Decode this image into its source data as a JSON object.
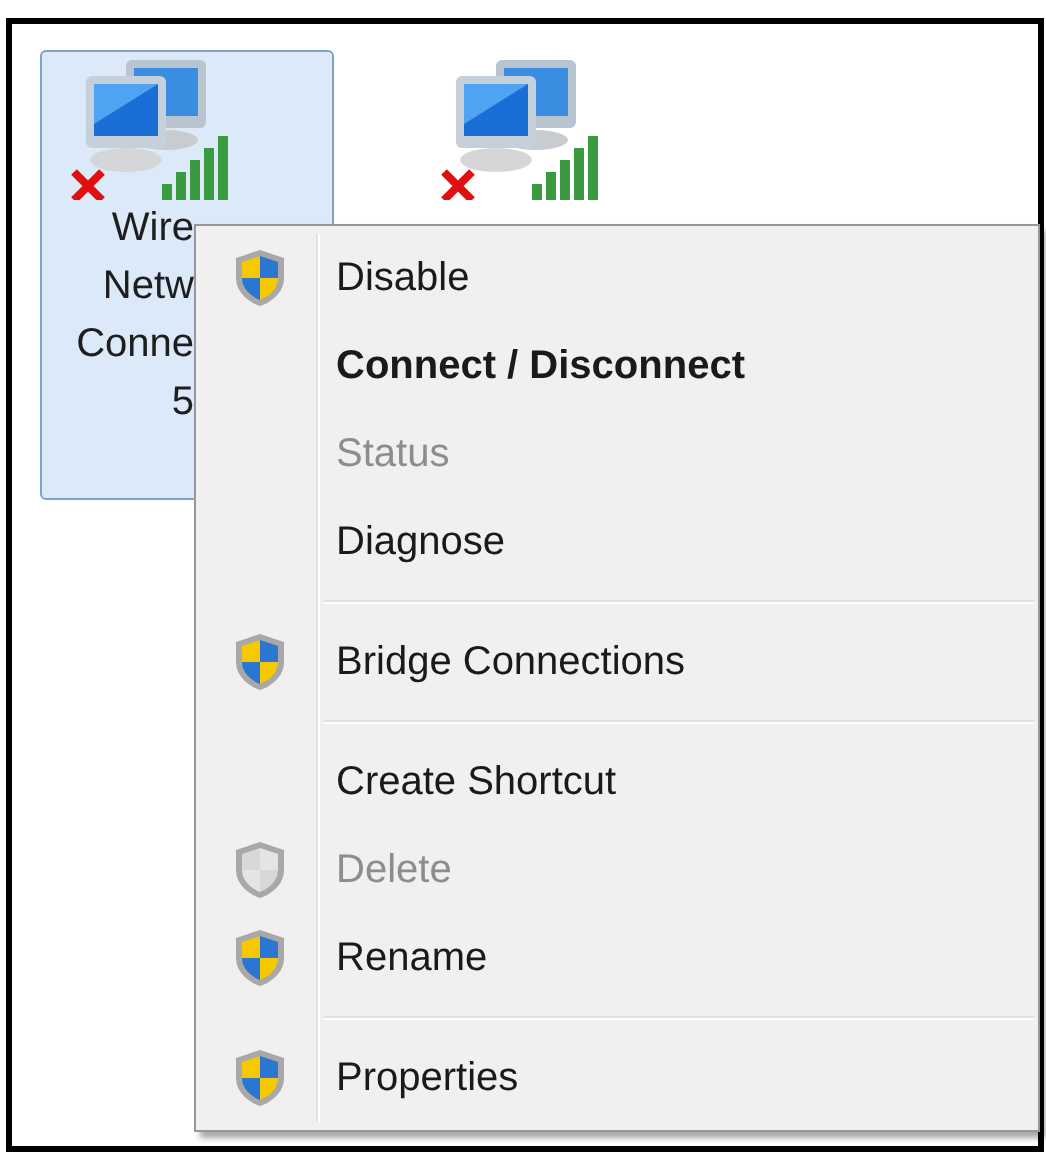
{
  "icons": [
    {
      "label_lines": [
        "Wire",
        "Netw",
        "Conne",
        "5"
      ],
      "selected": true,
      "disconnected": true
    },
    {
      "selected": false,
      "disconnected": true
    }
  ],
  "context_menu": {
    "items": [
      {
        "kind": "item",
        "label": "Disable",
        "shield": true,
        "default": false,
        "disabled": false
      },
      {
        "kind": "item",
        "label": "Connect / Disconnect",
        "shield": false,
        "default": true,
        "disabled": false
      },
      {
        "kind": "item",
        "label": "Status",
        "shield": false,
        "default": false,
        "disabled": true
      },
      {
        "kind": "item",
        "label": "Diagnose",
        "shield": false,
        "default": false,
        "disabled": false
      },
      {
        "kind": "separator"
      },
      {
        "kind": "item",
        "label": "Bridge Connections",
        "shield": true,
        "default": false,
        "disabled": false
      },
      {
        "kind": "separator"
      },
      {
        "kind": "item",
        "label": "Create Shortcut",
        "shield": false,
        "default": false,
        "disabled": false
      },
      {
        "kind": "item",
        "label": "Delete",
        "shield": true,
        "default": false,
        "disabled": true
      },
      {
        "kind": "item",
        "label": "Rename",
        "shield": true,
        "default": false,
        "disabled": false
      },
      {
        "kind": "separator"
      },
      {
        "kind": "item",
        "label": "Properties",
        "shield": true,
        "default": false,
        "disabled": false
      }
    ]
  }
}
